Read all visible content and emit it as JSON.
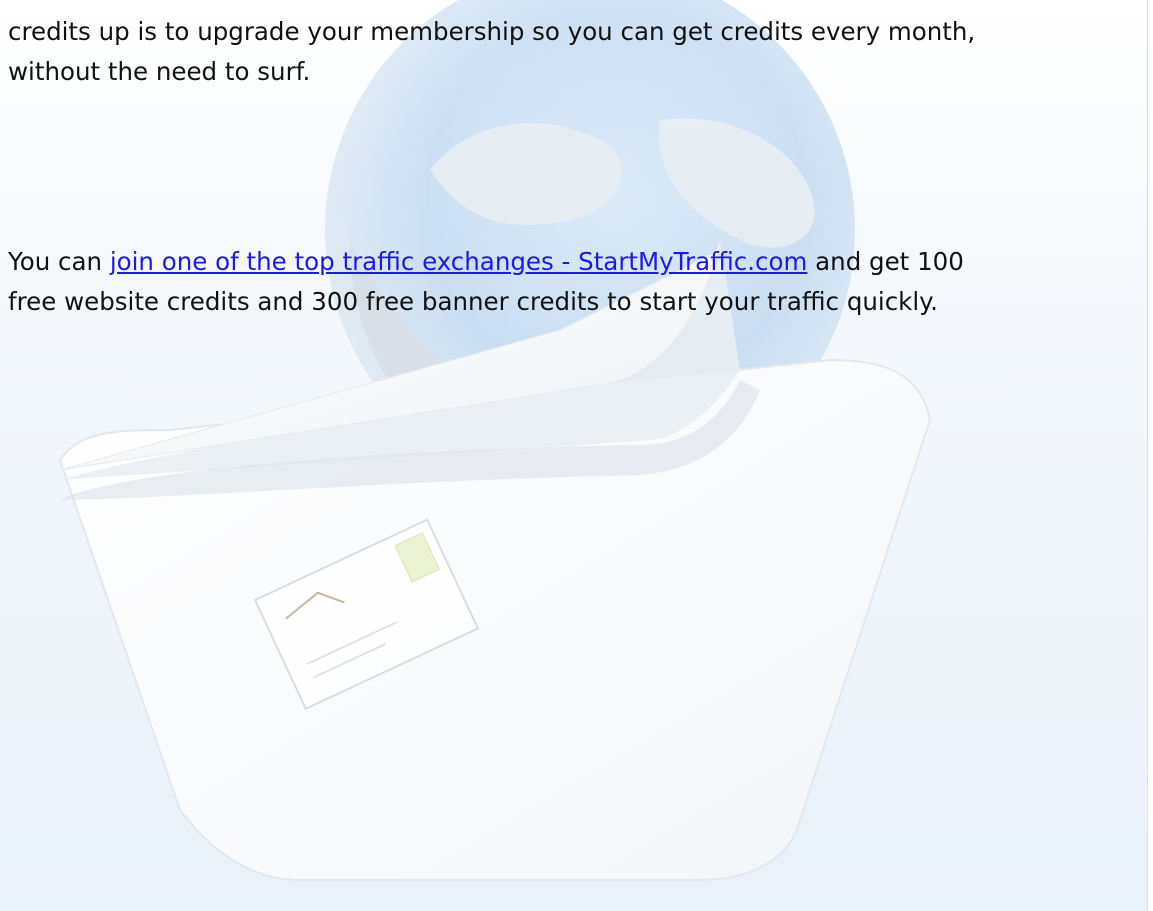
{
  "paragraphs": {
    "first": {
      "line1": "credits up is to upgrade your membership so you can get credits every month,",
      "line2": "without the need to surf."
    },
    "second": {
      "prefix": "You can ",
      "link_text": "join one of the top traffic exchanges -  StartMyTraffic.com",
      "suffix_line1": " and get 100",
      "line2": "free website credits and 300 free banner credits to start your traffic quickly."
    }
  },
  "background": {
    "description_icon": "envelope-over-globe-watermark",
    "colors": {
      "globe_blue": "#9ec3e6",
      "globe_gray": "#c9d2db",
      "envelope_white": "#ffffff",
      "page_fade": "#eef4fa"
    }
  },
  "link_color": "#1a1ae6"
}
